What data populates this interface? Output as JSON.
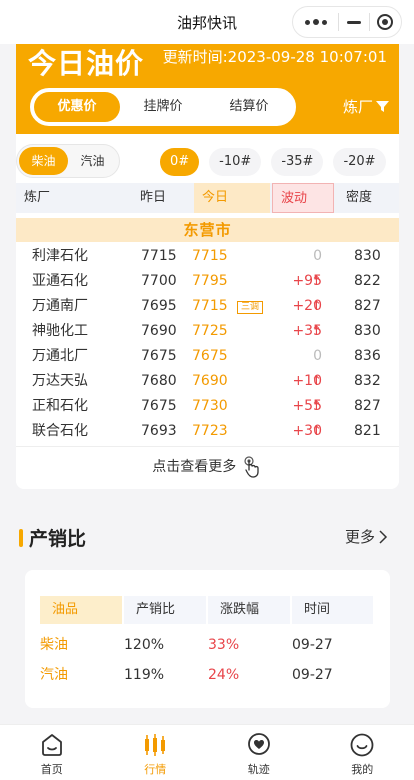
{
  "app": {
    "title": "油邦快讯"
  },
  "header": {
    "title": "今日油价",
    "updated": "更新时间:2023-09-28 10:07:01",
    "price_tabs": [
      "优惠价",
      "挂牌价",
      "结算价"
    ],
    "active_price_tab": 0,
    "refinery_filter": "炼厂"
  },
  "filters": {
    "fuel_types": [
      "柴油",
      "汽油"
    ],
    "active_fuel": 0,
    "grades": [
      "0#",
      "-10#",
      "-35#",
      "-20#"
    ],
    "active_grade": 0
  },
  "table": {
    "headers": {
      "refinery": "炼厂",
      "yesterday": "昨日",
      "today": "今日",
      "change": "波动",
      "density": "密度"
    },
    "city": "东营市",
    "rows": [
      {
        "name": "利津石化",
        "yesterday": "7715",
        "today": "7715",
        "change": "0",
        "up": false,
        "density": "830",
        "tag": ""
      },
      {
        "name": "亚通石化",
        "yesterday": "7700",
        "today": "7795",
        "change": "+95",
        "up": true,
        "density": "822",
        "tag": ""
      },
      {
        "name": "万通南厂",
        "yesterday": "7695",
        "today": "7715",
        "change": "+20",
        "up": true,
        "density": "827",
        "tag": "三调"
      },
      {
        "name": "神驰化工",
        "yesterday": "7690",
        "today": "7725",
        "change": "+35",
        "up": true,
        "density": "830",
        "tag": ""
      },
      {
        "name": "万通北厂",
        "yesterday": "7675",
        "today": "7675",
        "change": "0",
        "up": false,
        "density": "836",
        "tag": ""
      },
      {
        "name": "万达天弘",
        "yesterday": "7680",
        "today": "7690",
        "change": "+10",
        "up": true,
        "density": "832",
        "tag": ""
      },
      {
        "name": "正和石化",
        "yesterday": "7675",
        "today": "7730",
        "change": "+55",
        "up": true,
        "density": "827",
        "tag": ""
      },
      {
        "name": "联合石化",
        "yesterday": "7693",
        "today": "7723",
        "change": "+30",
        "up": true,
        "density": "821",
        "tag": ""
      }
    ],
    "more": "点击查看更多"
  },
  "ratio_section": {
    "title": "产销比",
    "more": "更多",
    "headers": {
      "product": "油品",
      "ratio": "产销比",
      "change": "涨跌幅",
      "time": "时间"
    },
    "rows": [
      {
        "product": "柴油",
        "ratio": "120%",
        "change": "33%",
        "time": "09-27"
      },
      {
        "product": "汽油",
        "ratio": "119%",
        "change": "24%",
        "time": "09-27"
      }
    ]
  },
  "nav": {
    "items": [
      {
        "label": "首页",
        "icon": "home-icon"
      },
      {
        "label": "行情",
        "icon": "candlestick-icon"
      },
      {
        "label": "轨迹",
        "icon": "track-icon"
      },
      {
        "label": "我的",
        "icon": "profile-icon"
      }
    ],
    "active": 1
  },
  "colors": {
    "accent": "#f7a800",
    "up": "#e8454a",
    "muted": "#bbbbbb"
  }
}
